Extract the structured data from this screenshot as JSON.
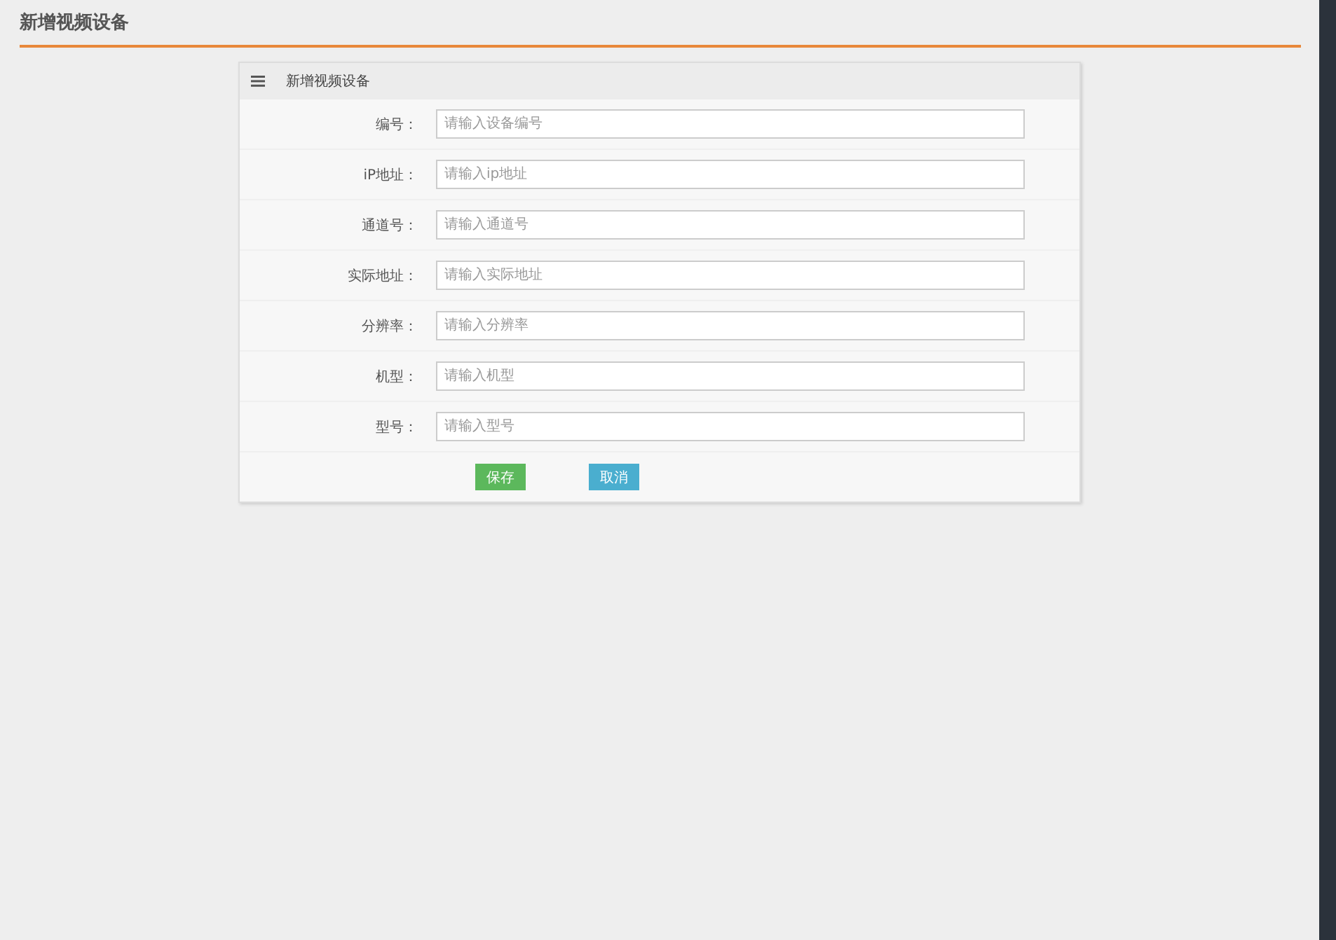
{
  "page_title": "新增视频设备",
  "panel": {
    "title": "新增视频设备",
    "fields": [
      {
        "label": "编号：",
        "placeholder": "请输入设备编号"
      },
      {
        "label": "iP地址：",
        "placeholder": "请输入ip地址"
      },
      {
        "label": "通道号：",
        "placeholder": "请输入通道号"
      },
      {
        "label": "实际地址：",
        "placeholder": "请输入实际地址"
      },
      {
        "label": "分辨率：",
        "placeholder": "请输入分辨率"
      },
      {
        "label": "机型：",
        "placeholder": "请输入机型"
      },
      {
        "label": "型号：",
        "placeholder": "请输入型号"
      }
    ],
    "buttons": [
      {
        "label": "保存",
        "kind": "primary"
      },
      {
        "label": "取消",
        "kind": "secondary"
      }
    ]
  }
}
